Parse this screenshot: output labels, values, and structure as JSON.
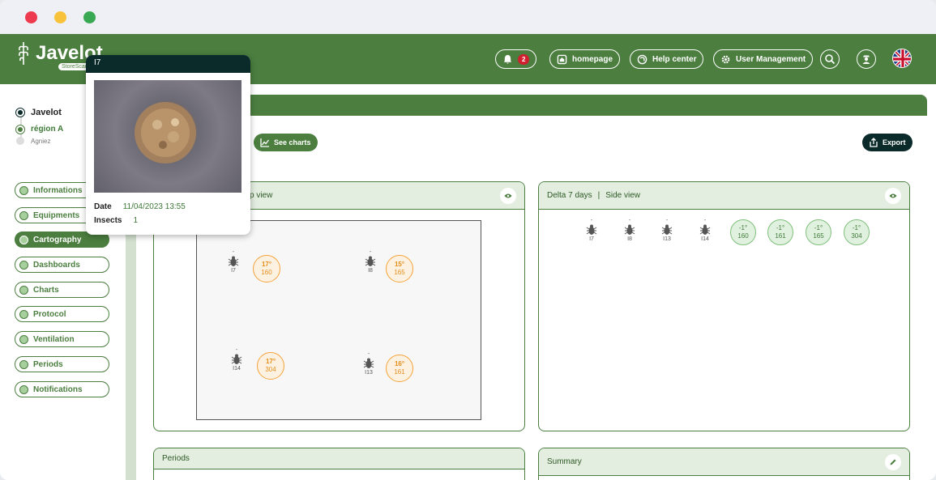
{
  "header": {
    "logo": "Javelot",
    "logo_sub": "StoreScan",
    "notifications_count": "2",
    "homepage": "homepage",
    "help_center": "Help center",
    "user_management": "User Management"
  },
  "tree": {
    "root": "Javelot",
    "region": "région A",
    "site": "Agniez"
  },
  "nav": [
    "Informations",
    "Equipments",
    "Cartography",
    "Dashboards",
    "Charts",
    "Protocol",
    "Ventilation",
    "Periods",
    "Notifications"
  ],
  "toolbar": {
    "see_charts": "See charts",
    "export": "Export"
  },
  "top_view": {
    "title": "Top view",
    "title_visible": "p view",
    "sensors": [
      {
        "id": "I7",
        "dash": "-",
        "temp": "17°",
        "value": "160"
      },
      {
        "id": "I8",
        "dash": "-",
        "temp": "15°",
        "value": "165"
      },
      {
        "id": "I14",
        "dash": "-",
        "temp": "17°",
        "value": "304"
      },
      {
        "id": "I13",
        "dash": "-",
        "temp": "16°",
        "value": "161"
      }
    ]
  },
  "side_view": {
    "delta_label": "Delta 7 days",
    "title": "Side view",
    "sensors": [
      {
        "id": "I7",
        "dash": "-"
      },
      {
        "id": "I8",
        "dash": "-"
      },
      {
        "id": "I13",
        "dash": "-"
      },
      {
        "id": "I14",
        "dash": "-"
      }
    ],
    "deltas": [
      {
        "temp": "-1°",
        "value": "160"
      },
      {
        "temp": "-1°",
        "value": "161"
      },
      {
        "temp": "-1°",
        "value": "165"
      },
      {
        "temp": "-1°",
        "value": "304"
      }
    ]
  },
  "periods": {
    "title": "Periods"
  },
  "summary": {
    "title": "Summary"
  },
  "tooltip": {
    "title": "I7",
    "date_label": "Date",
    "date_value": "11/04/2023 13:55",
    "insects_label": "Insects",
    "insects_value": "1"
  },
  "colors": {
    "primary": "#4b7e3f",
    "dark": "#0b2b2b",
    "orange": "#f6a33a",
    "badge": "#d0202f"
  }
}
